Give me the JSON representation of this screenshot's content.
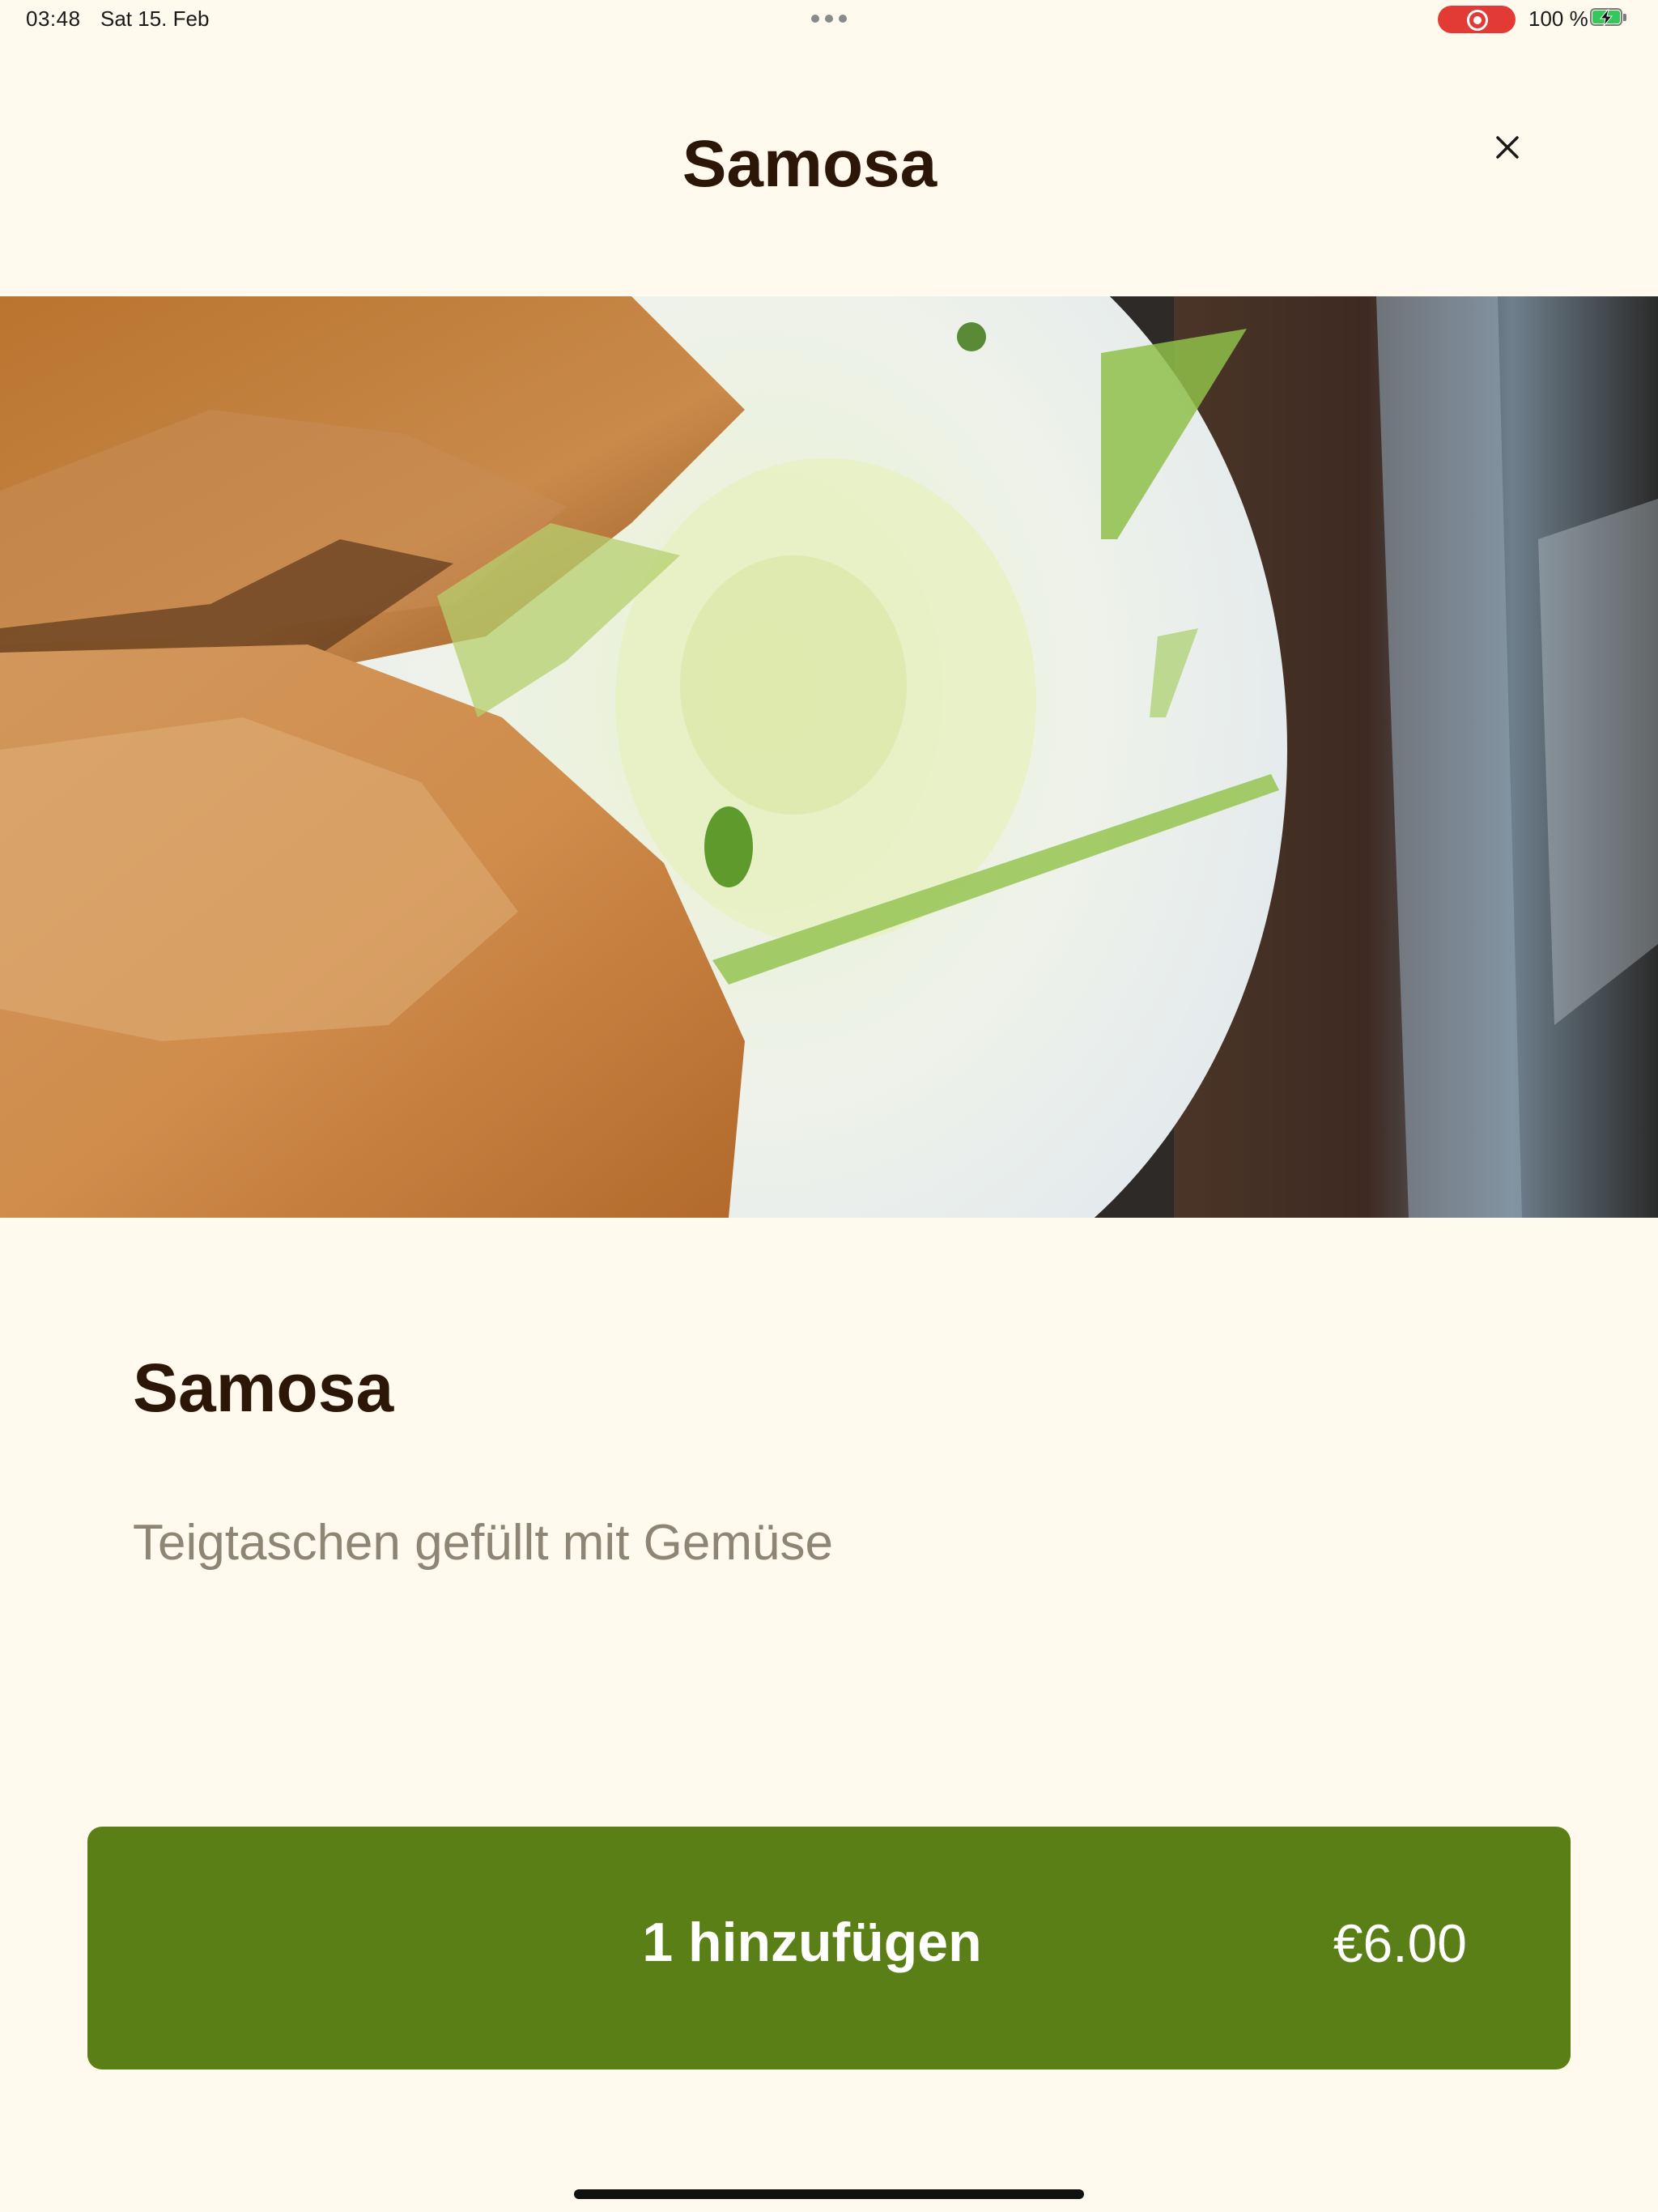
{
  "status_bar": {
    "time": "03:48",
    "date": "Sat 15. Feb",
    "battery_percent": "100 %",
    "battery_level": 1.0,
    "charging": true,
    "screen_recording": true,
    "recording_color": "#e23a35"
  },
  "header": {
    "title": "Samosa",
    "close_icon": "close-icon"
  },
  "hero_image": {
    "subject": "samosa-photo"
  },
  "item": {
    "name": "Samosa",
    "description": "Teigtaschen gefüllt mit Gemüse"
  },
  "add_button": {
    "label": "1 hinzufügen",
    "price": "€6.00",
    "color": "#5b7f17"
  },
  "colors": {
    "background": "#fff9ee",
    "title_text": "#2b1608",
    "description_text": "#8f8574"
  }
}
